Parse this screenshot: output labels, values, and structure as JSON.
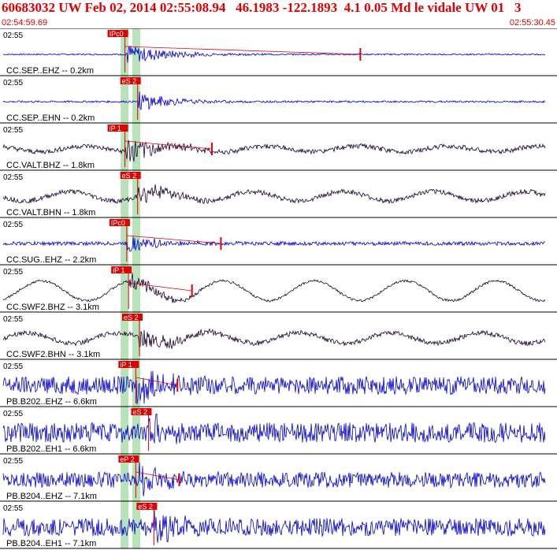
{
  "header": {
    "title": "60683032 UW Feb 02, 2014 02:55:08.94   46.1983 -122.1893  4.1 0.05 Md le vidale UW 01   3",
    "start_time": "02:54:59.69",
    "end_time": "02:55:30.45"
  },
  "colors": {
    "header_text": "#e00000",
    "trace_blue": "#0000d0",
    "trace_dark": "#1a0030",
    "pick_box": "#e00000",
    "pick_window": "#b8e2b8",
    "separator": "#000000"
  },
  "chart_data": {
    "type": "line",
    "time_range": [
      "02:54:59.69",
      "02:55:30.45"
    ],
    "pick_windows": [
      6.75,
      7.4
    ],
    "traces": [
      {
        "label": "CC.SEP..EHZ -- 0.2km",
        "time_tick": "02:55",
        "pick": "IPc0",
        "pick_t": 6.9,
        "color": "blue",
        "amp": 0.45,
        "noise": 0.03,
        "coda": 5,
        "lf": 0,
        "end_mark": 19.9
      },
      {
        "label": "CC.SEP..EHN -- 0.2km",
        "time_tick": "02:55",
        "pick": "eS 2",
        "pick_t": 7.6,
        "color": "blue",
        "amp": 0.4,
        "noise": 0.04,
        "coda": 4,
        "lf": 0,
        "end_mark": null
      },
      {
        "label": "CC.VALT.BHZ -- 1.8km",
        "time_tick": "02:55",
        "pick": "iP 1",
        "pick_t": 6.9,
        "color": "dark",
        "amp": 0.55,
        "noise": 0.1,
        "coda": 4,
        "lf": 0.12,
        "end_mark": 11.7
      },
      {
        "label": "CC.VALT.BHN -- 1.8km",
        "time_tick": "02:55",
        "pick": "eS 2",
        "pick_t": 7.6,
        "color": "dark",
        "amp": 0.45,
        "noise": 0.1,
        "coda": 4,
        "lf": 0.2,
        "end_mark": null
      },
      {
        "label": "CC.SUG..EHZ -- 2.2km",
        "time_tick": "02:55",
        "pick": "IPc0",
        "pick_t": 7.0,
        "color": "blue",
        "amp": 0.35,
        "noise": 0.08,
        "coda": 4,
        "lf": 0,
        "end_mark": 12.2
      },
      {
        "label": "CC.SWF2.BHZ -- 3.1km",
        "time_tick": "02:55",
        "pick": "iP 1",
        "pick_t": 7.1,
        "color": "dark",
        "amp": 0.4,
        "noise": 0.05,
        "coda": 4,
        "lf": 0.42,
        "end_mark": 10.6
      },
      {
        "label": "CC.SWF2.BHN -- 3.1km",
        "time_tick": "02:55",
        "pick": "eS 2",
        "pick_t": 7.7,
        "color": "dark",
        "amp": 0.42,
        "noise": 0.1,
        "coda": 5,
        "lf": 0.22,
        "end_mark": null
      },
      {
        "label": "PB.B202..EHZ -- 6.6km",
        "time_tick": "02:55",
        "pick": "iP 1",
        "pick_t": 7.5,
        "color": "blue",
        "amp": 0.6,
        "noise": 0.38,
        "coda": 3,
        "lf": 0,
        "end_mark": 9.8
      },
      {
        "label": "PB.B202..EH1 -- 6.6km",
        "time_tick": "02:55",
        "pick": "eS 2",
        "pick_t": 8.2,
        "color": "blue",
        "amp": 0.55,
        "noise": 0.42,
        "coda": 3,
        "lf": 0,
        "end_mark": null
      },
      {
        "label": "PB.B204..EHZ -- 7.1km",
        "time_tick": "02:55",
        "pick": "eP 2",
        "pick_t": 7.5,
        "color": "blue",
        "amp": 0.55,
        "noise": 0.33,
        "coda": 3,
        "lf": 0,
        "end_mark": 9.9
      },
      {
        "label": "PB.B204..EH1 -- 7.1km",
        "time_tick": "02:55",
        "pick": "eS 2",
        "pick_t": 8.5,
        "color": "blue",
        "amp": 0.55,
        "noise": 0.38,
        "coda": 3,
        "lf": 0,
        "end_mark": null
      }
    ]
  }
}
